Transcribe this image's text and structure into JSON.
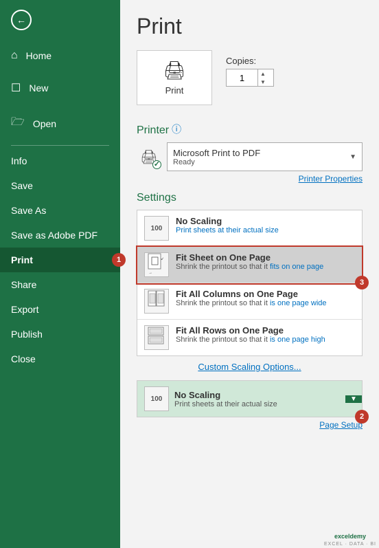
{
  "sidebar": {
    "items": [
      {
        "id": "home",
        "label": "Home",
        "icon": "⌂"
      },
      {
        "id": "new",
        "label": "New",
        "icon": "☐"
      },
      {
        "id": "open",
        "label": "Open",
        "icon": "📂"
      }
    ],
    "text_items": [
      {
        "id": "info",
        "label": "Info"
      },
      {
        "id": "save",
        "label": "Save"
      },
      {
        "id": "save-as",
        "label": "Save As"
      },
      {
        "id": "save-adobe",
        "label": "Save as Adobe PDF"
      },
      {
        "id": "print",
        "label": "Print",
        "active": true
      },
      {
        "id": "share",
        "label": "Share"
      },
      {
        "id": "export",
        "label": "Export"
      },
      {
        "id": "publish",
        "label": "Publish"
      },
      {
        "id": "close",
        "label": "Close"
      }
    ]
  },
  "main": {
    "title": "Print",
    "print_button_label": "Print",
    "copies_label": "Copies:",
    "copies_value": "1",
    "printer_section": "Printer",
    "printer_name": "Microsoft Print to PDF",
    "printer_status": "Ready",
    "printer_properties": "Printer Properties",
    "settings_section": "Settings",
    "settings_items": [
      {
        "id": "no-scaling",
        "title": "No Scaling",
        "desc": "Print sheets at their actual size",
        "selected": false,
        "icon_text": "100"
      },
      {
        "id": "fit-sheet",
        "title": "Fit Sheet on One Page",
        "desc": "Shrink the printout so that it fits on one page",
        "selected": true,
        "icon_text": ""
      },
      {
        "id": "fit-columns",
        "title": "Fit All Columns on One Page",
        "desc": "Shrink the printout so that it is one page wide",
        "selected": false,
        "icon_text": ""
      },
      {
        "id": "fit-rows",
        "title": "Fit All Rows on One Page",
        "desc": "Shrink the printout so that it is one page high",
        "selected": false,
        "icon_text": ""
      }
    ],
    "custom_scaling": "Custom Scaling Options...",
    "bottom_no_scaling": "No Scaling",
    "bottom_desc": "Print sheets at their actual size",
    "page_setup": "Page Setup"
  },
  "badges": {
    "badge1": "1",
    "badge2": "2",
    "badge3": "3"
  },
  "watermark": "exceldemy\nEXCEL · DATA · BI"
}
